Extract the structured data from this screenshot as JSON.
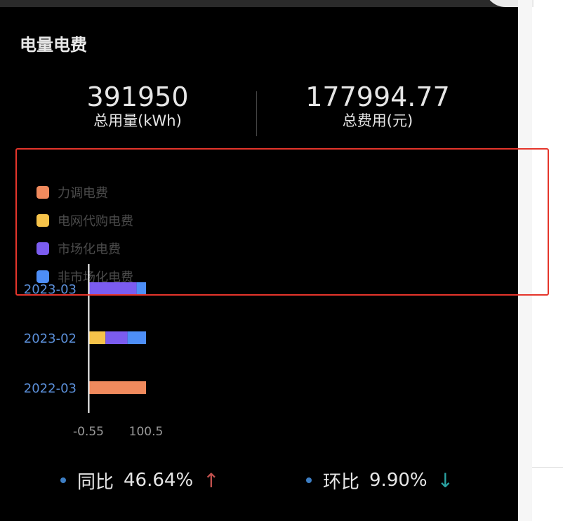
{
  "card": {
    "title": "电量电费",
    "total_usage": {
      "value": "391950",
      "label": "总用量(kWh)"
    },
    "total_cost": {
      "value": "177994.77",
      "label": "总费用(元)"
    }
  },
  "colors": {
    "accent_dot": "#3d7ec4",
    "yoy_arrow": "#c0504d",
    "mom_arrow": "#2aa3a3",
    "highlight_box": "#e5352b"
  },
  "chart_data": {
    "type": "bar",
    "orientation": "horizontal",
    "stacked": true,
    "legend_position": "top-left",
    "legend": [
      {
        "name": "力调电费",
        "color": "#f08a5d"
      },
      {
        "name": "电网代购电费",
        "color": "#f6c34a"
      },
      {
        "name": "市场化电费",
        "color": "#7b5cf0"
      },
      {
        "name": "非市场化电费",
        "color": "#4d8ef7"
      }
    ],
    "categories": [
      "2023-03",
      "2023-02",
      "2022-03"
    ],
    "series": [
      {
        "name": "力调电费",
        "values": [
          0,
          0,
          100.5
        ]
      },
      {
        "name": "电网代购电费",
        "values": [
          0,
          29.3,
          0
        ]
      },
      {
        "name": "市场化电费",
        "values": [
          84.0,
          38.7,
          0
        ]
      },
      {
        "name": "非市场化电费",
        "values": [
          16.5,
          32.5,
          0
        ]
      }
    ],
    "xlim": [
      -0.55,
      100.5
    ],
    "xticks": [
      "-0.55",
      "100.5"
    ]
  },
  "footer": {
    "yoy": {
      "label": "同比",
      "value": "46.64%",
      "arrow": "↑"
    },
    "mom": {
      "label": "环比",
      "value": "9.90%",
      "arrow": "↓"
    }
  }
}
